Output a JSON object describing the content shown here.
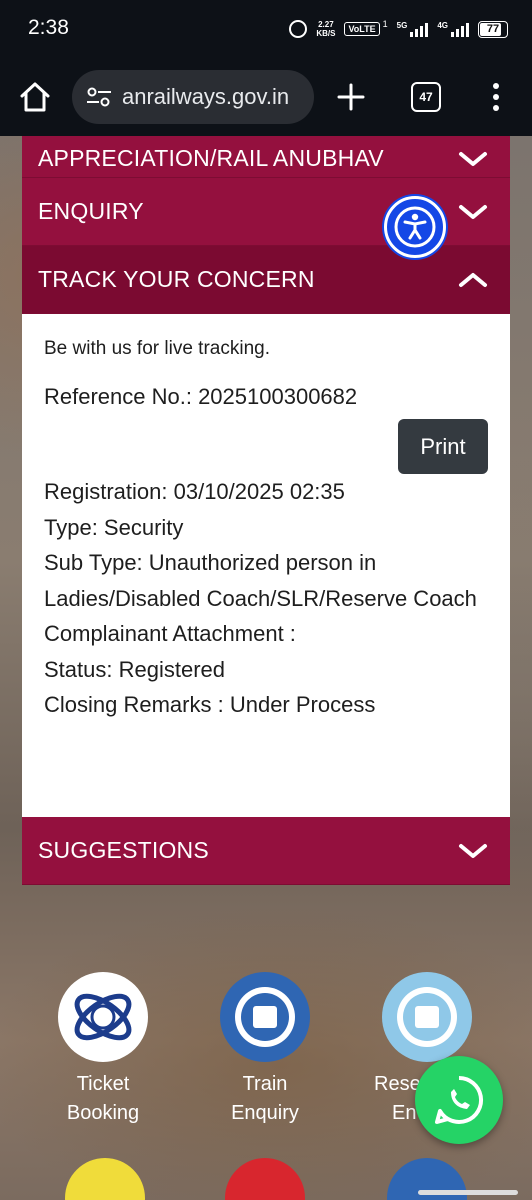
{
  "status_bar": {
    "time": "2:38",
    "speed_value": "2.27",
    "speed_unit": "KB/S",
    "volte": "VoLTE",
    "volte_sup": "1",
    "net1": "5G",
    "net2": "4G",
    "battery": "77"
  },
  "browser": {
    "url": "anrailways.gov.in",
    "tab_count": "47"
  },
  "accordion": {
    "appreciation": "APPRECIATION/RAIL ANUBHAV",
    "enquiry": "ENQUIRY",
    "track": "TRACK YOUR CONCERN",
    "suggestions": "SUGGESTIONS"
  },
  "concern": {
    "intro": "Be with us for live tracking.",
    "reference": "Reference No.: 2025100300682",
    "print_label": "Print",
    "registration": "Registration: 03/10/2025 02:35",
    "type": "Type: Security",
    "sub_type": "Sub Type: Unauthorized person in Ladies/Disabled Coach/SLR/Reserve Coach",
    "attachment": "Complainant Attachment :",
    "status": "Status: Registered",
    "closing": "Closing Remarks : Under Process"
  },
  "shortcuts": [
    {
      "line1": "Ticket",
      "line2": "Booking"
    },
    {
      "line1": "Train",
      "line2": "Enquiry"
    },
    {
      "line1": "Reser",
      "line2": "En"
    }
  ],
  "colors": {
    "accordion": "#94103e",
    "accordion_active": "#7b0a31",
    "print_button": "#343a40",
    "whatsapp": "#25d366",
    "accessibility": "#1447e6"
  }
}
